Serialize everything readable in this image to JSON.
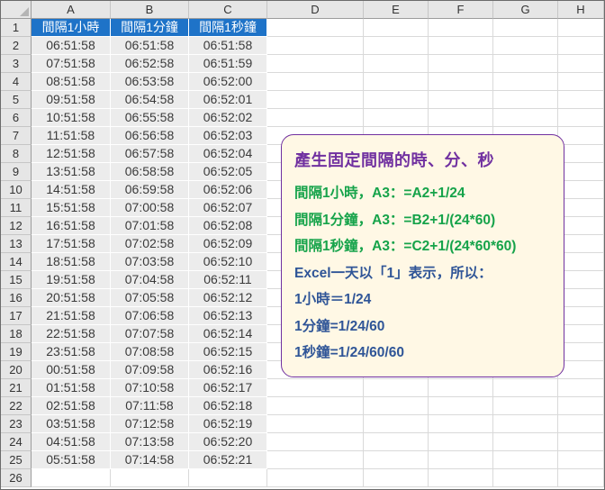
{
  "sheet": {
    "columns": [
      "A",
      "B",
      "C",
      "D",
      "E",
      "F",
      "G",
      "H"
    ],
    "header_row": [
      "間隔1小時",
      "間隔1分鐘",
      "間隔1秒鐘"
    ],
    "rows": [
      [
        "06:51:58",
        "06:51:58",
        "06:51:58"
      ],
      [
        "07:51:58",
        "06:52:58",
        "06:51:59"
      ],
      [
        "08:51:58",
        "06:53:58",
        "06:52:00"
      ],
      [
        "09:51:58",
        "06:54:58",
        "06:52:01"
      ],
      [
        "10:51:58",
        "06:55:58",
        "06:52:02"
      ],
      [
        "11:51:58",
        "06:56:58",
        "06:52:03"
      ],
      [
        "12:51:58",
        "06:57:58",
        "06:52:04"
      ],
      [
        "13:51:58",
        "06:58:58",
        "06:52:05"
      ],
      [
        "14:51:58",
        "06:59:58",
        "06:52:06"
      ],
      [
        "15:51:58",
        "07:00:58",
        "06:52:07"
      ],
      [
        "16:51:58",
        "07:01:58",
        "06:52:08"
      ],
      [
        "17:51:58",
        "07:02:58",
        "06:52:09"
      ],
      [
        "18:51:58",
        "07:03:58",
        "06:52:10"
      ],
      [
        "19:51:58",
        "07:04:58",
        "06:52:11"
      ],
      [
        "20:51:58",
        "07:05:58",
        "06:52:12"
      ],
      [
        "21:51:58",
        "07:06:58",
        "06:52:13"
      ],
      [
        "22:51:58",
        "07:07:58",
        "06:52:14"
      ],
      [
        "23:51:58",
        "07:08:58",
        "06:52:15"
      ],
      [
        "00:51:58",
        "07:09:58",
        "06:52:16"
      ],
      [
        "01:51:58",
        "07:10:58",
        "06:52:17"
      ],
      [
        "02:51:58",
        "07:11:58",
        "06:52:18"
      ],
      [
        "03:51:58",
        "07:12:58",
        "06:52:19"
      ],
      [
        "04:51:58",
        "07:13:58",
        "06:52:20"
      ],
      [
        "05:51:58",
        "07:14:58",
        "06:52:21"
      ]
    ],
    "row_count": 26
  },
  "note": {
    "title": "產生固定間隔的時、分、秒",
    "lines": [
      {
        "text": "間隔1小時，A3：=A2+1/24",
        "color": "green"
      },
      {
        "text": "間隔1分鐘，A3：=B2+1/(24*60)",
        "color": "green"
      },
      {
        "text": "間隔1秒鐘，A3：=C2+1/(24*60*60)",
        "color": "green"
      },
      {
        "text": "Excel一天以「1」表示，所以：",
        "color": "navy"
      },
      {
        "text": "1小時＝1/24",
        "color": "navy"
      },
      {
        "text": "1分鐘=1/24/60",
        "color": "navy"
      },
      {
        "text": "1秒鐘=1/24/60/60",
        "color": "navy"
      }
    ]
  },
  "colors": {
    "header_fill": "#1e73c8",
    "data_fill": "#ececec",
    "note_border": "#7030a0",
    "note_fill": "#fff8e5",
    "formula_text": "#16a34a",
    "explain_text": "#2f5597"
  }
}
